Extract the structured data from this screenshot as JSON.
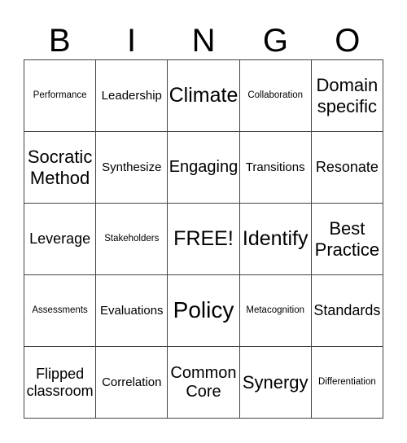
{
  "header": {
    "letters": [
      "B",
      "I",
      "N",
      "G",
      "O"
    ]
  },
  "card": {
    "rows": [
      [
        "Performance",
        "Leadership",
        "Climate",
        "Collaboration",
        "Domain specific"
      ],
      [
        "Socratic Method",
        "Synthesize",
        "Engaging",
        "Transitions",
        "Resonate"
      ],
      [
        "Leverage",
        "Stakeholders",
        "FREE!",
        "Identify",
        "Best Practice"
      ],
      [
        "Assessments",
        "Evaluations",
        "Policy",
        "Metacognition",
        "Standards"
      ],
      [
        "Flipped classroom",
        "Correlation",
        "Common Core",
        "Synergy",
        "Differentiation"
      ]
    ]
  }
}
